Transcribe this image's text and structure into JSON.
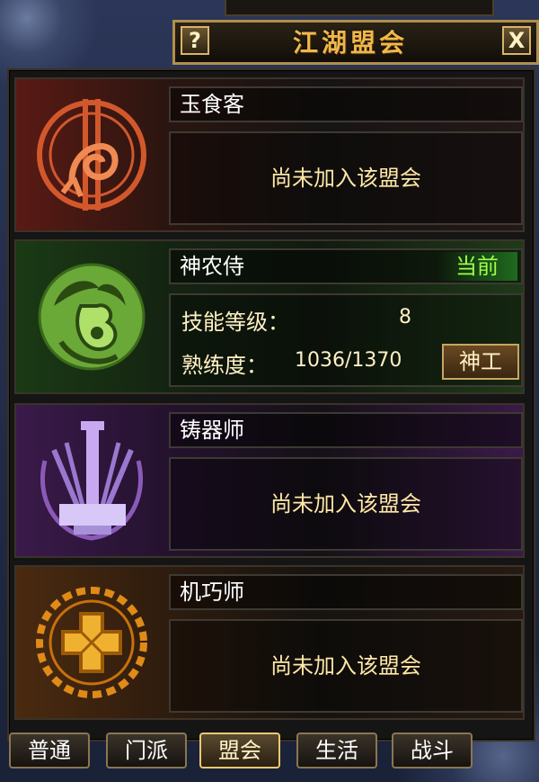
{
  "window": {
    "title": "江湖盟会",
    "help_label": "?",
    "close_label": "X"
  },
  "guilds": [
    {
      "name": "玉食客",
      "status": "尚未加入该盟会",
      "theme": "red",
      "icon": "fish-emblem-icon",
      "color": "#d2582c"
    },
    {
      "name": "神农侍",
      "current_badge": "当前",
      "theme": "green",
      "icon": "gourd-emblem-icon",
      "color": "#8ed04a",
      "skill_level_label": "技能等级：",
      "skill_level_value": "8",
      "proficiency_label": "熟练度：",
      "proficiency_value": "1036/1370",
      "title_button": "神工"
    },
    {
      "name": "铸器师",
      "status": "尚未加入该盟会",
      "theme": "purple",
      "icon": "hammer-swords-emblem-icon",
      "color": "#b58ae0"
    },
    {
      "name": "机巧师",
      "status": "尚未加入该盟会",
      "theme": "orange",
      "icon": "gear-cross-emblem-icon",
      "color": "#f0a020"
    }
  ],
  "tabs": [
    {
      "label": "普通",
      "active": false
    },
    {
      "label": "门派",
      "active": false
    },
    {
      "label": "盟会",
      "active": true
    },
    {
      "label": "生活",
      "active": false
    },
    {
      "label": "战斗",
      "active": false
    }
  ]
}
